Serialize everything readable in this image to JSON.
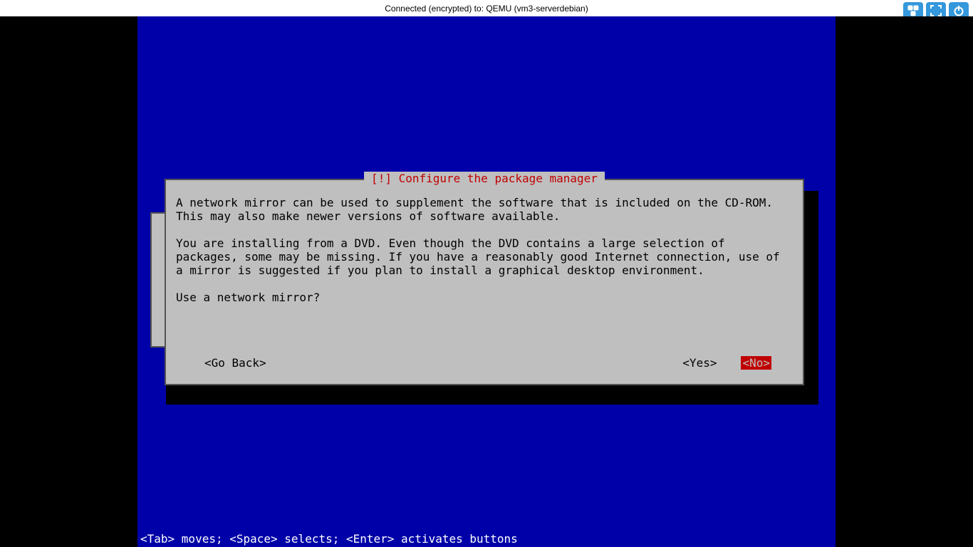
{
  "topbar": {
    "connection_text": "Connected (encrypted) to: QEMU (vm3-serverdebian)",
    "icons": {
      "ctrl_alt_del": "ctrl-alt-del-icon",
      "fullscreen": "fullscreen-icon",
      "power": "power-icon"
    }
  },
  "dialog": {
    "title": "[!] Configure the package manager",
    "paragraph1": "A network mirror can be used to supplement the software that is included on the CD-ROM.\nThis may also make newer versions of software available.",
    "paragraph2": "You are installing from a DVD. Even though the DVD contains a large selection of\npackages, some may be missing. If you have a reasonably good Internet connection, use of\na mirror is suggested if you plan to install a graphical desktop environment.",
    "question": "Use a network mirror?",
    "go_back_label": "<Go Back>",
    "yes_label": "<Yes>",
    "no_label": "<No>",
    "selected": "no"
  },
  "hint_bar": "<Tab> moves; <Space> selects; <Enter> activates buttons"
}
